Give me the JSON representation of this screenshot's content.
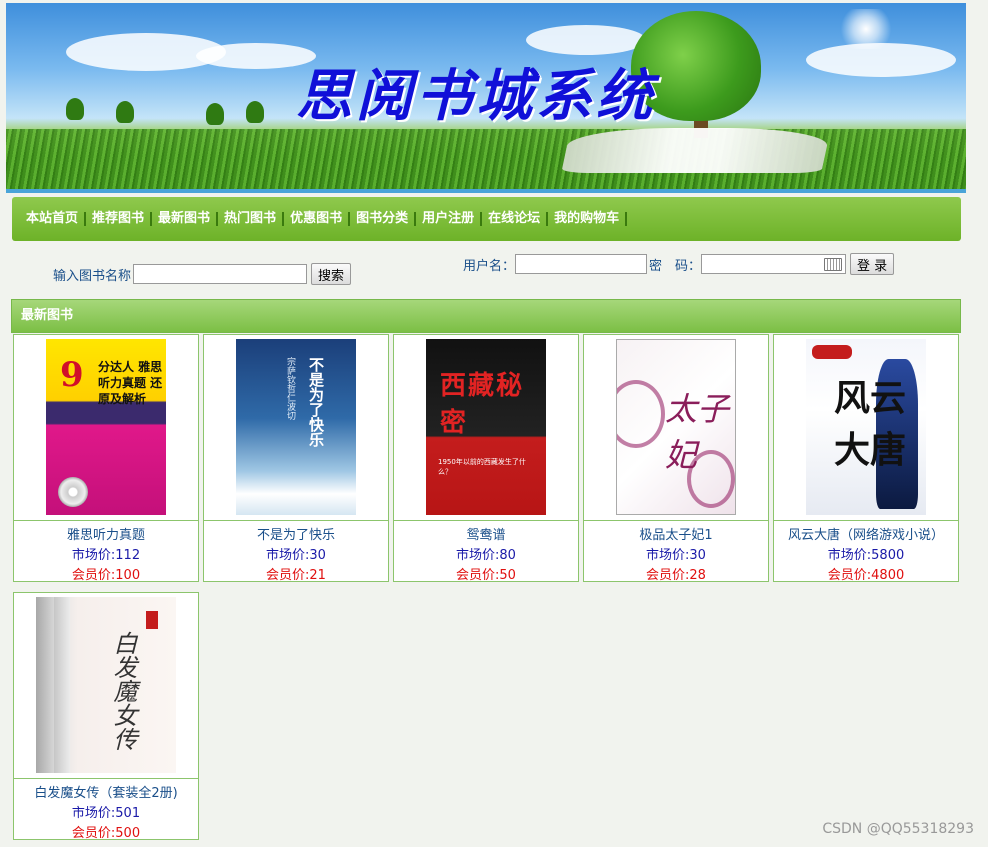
{
  "banner": {
    "title": "思阅书城系统"
  },
  "nav": {
    "items": [
      "本站首页",
      "推荐图书",
      "最新图书",
      "热门图书",
      "优惠图书",
      "图书分类",
      "用户注册",
      "在线论坛",
      "我的购物车"
    ]
  },
  "search": {
    "label": "输入图书名称",
    "button": "搜索",
    "value": ""
  },
  "login": {
    "username_label": "用户名：",
    "password_label": "密　码：",
    "button": "登 录",
    "username_value": "",
    "password_value": ""
  },
  "section": {
    "title": "最新图书"
  },
  "books": [
    {
      "name": "雅思听力真题",
      "market": "市场价:112",
      "member": "会员价:100",
      "cover_text": "9",
      "cover_sub": "分达人 雅思听力真题 还原及解析"
    },
    {
      "name": "不是为了快乐",
      "market": "市场价:30",
      "member": "会员价:21",
      "cover_text": "不是为了快乐",
      "cover_sub": "宗萨钦哲仁波切"
    },
    {
      "name": "鸳鸯谱",
      "market": "市场价:80",
      "member": "会员价:50",
      "cover_text": "西藏秘密",
      "cover_sub": "1950年以前的西藏发生了什么？"
    },
    {
      "name": "极品太子妃1",
      "market": "市场价:30",
      "member": "会员价:28",
      "cover_text": "太子妃",
      "cover_sub": ""
    },
    {
      "name": "风云大唐（网络游戏小说）",
      "market": "市场价:5800",
      "member": "会员价:4800",
      "cover_text": "风云大唐",
      "cover_sub": ""
    },
    {
      "name": "白发魔女传（套装全2册)",
      "market": "市场价:501",
      "member": "会员价:500",
      "cover_text": "白发魔女传",
      "cover_sub": ""
    }
  ],
  "watermark": "CSDN @QQ55318293"
}
